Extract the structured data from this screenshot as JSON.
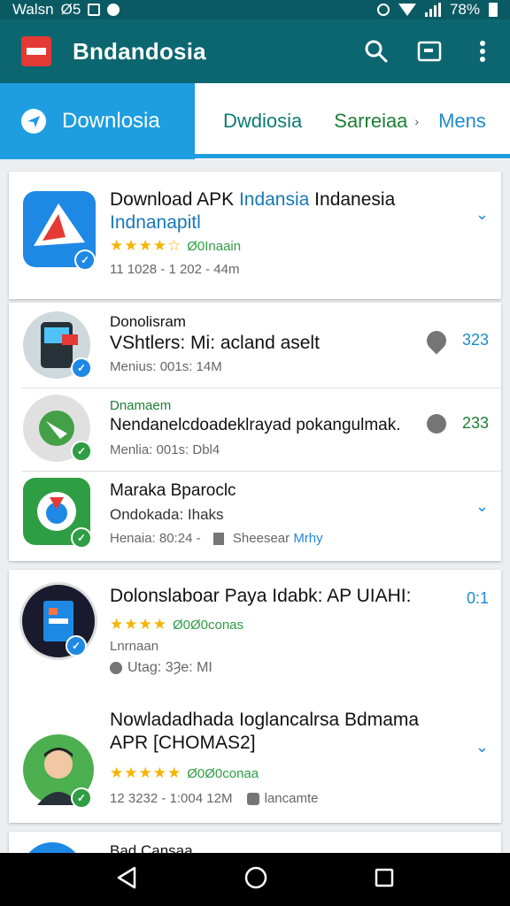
{
  "status_bar": {
    "carrier": "Walsn",
    "extra": "Ø5",
    "battery": "78%"
  },
  "app_bar": {
    "title": "Bndandosia",
    "icons": [
      "search-icon",
      "cast-icon",
      "more-vert-icon"
    ]
  },
  "tabs": [
    {
      "label": "Downlosia",
      "active": true,
      "icon": "plane-icon"
    },
    {
      "label": "Dwdiosia"
    },
    {
      "label": "Sarreiaa"
    },
    {
      "label": "Mens"
    }
  ],
  "featured": {
    "title_a": "Download APK ",
    "title_b": "Indansia",
    "title_c": " Indanesia",
    "subtitle": "Indnanapitl",
    "stars": "★★★★☆",
    "rating": "Ø0Inaain",
    "meta": "11 1028 - 1 202 - 44m"
  },
  "list1": [
    {
      "category": "Donolisram",
      "title": "VShtlers: Mi: acland aselt",
      "meta": "Menius: 001s: 14M",
      "value": "323"
    },
    {
      "category": "Dnamaem",
      "title": "Nendanelcdoadeklrayad pokangulmak.",
      "meta": "Menlia: 001s: Dbl4",
      "value": "233"
    },
    {
      "category": "",
      "title": "Maraka Bparoclc",
      "sub": "Ondokada: Ihaks",
      "meta_a": "Henaia: 80:24 -",
      "meta_b": "Sheesear",
      "meta_c": "Mrhy"
    }
  ],
  "list2": [
    {
      "title": "Dolonslaboar Paya Idabk: AP UIAHI:",
      "stars": "★★★★",
      "rating": "Ø0Ø0conas",
      "sub": "Lnrnaan",
      "meta": "Utag: 3Ȝe: MI",
      "value": "0:1"
    },
    {
      "title_l1": "Nowladadhada Ioglancalrsa Bdmama",
      "title_l2": "APR [CHOMAS2]",
      "stars": "★★★★★",
      "rating": "Ø0Ø0conaa",
      "meta": "12 3232 - 1:004 12M",
      "meta_b": "lancamte"
    }
  ],
  "peek": {
    "title": "Bad Cansaa"
  },
  "nav": [
    "back-icon",
    "home-icon",
    "recents-icon"
  ]
}
